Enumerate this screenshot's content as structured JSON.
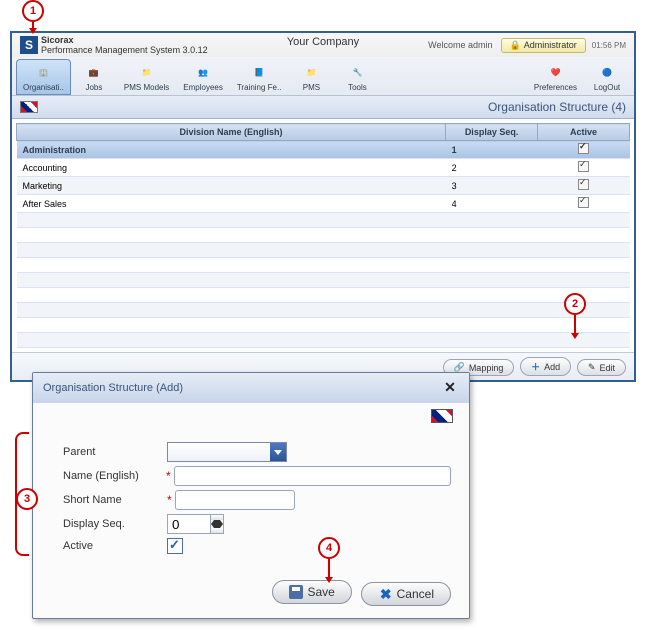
{
  "callouts": {
    "c1": "1",
    "c2": "2",
    "c3": "3",
    "c4": "4"
  },
  "header": {
    "app_name": "Sicorax",
    "subtitle": "Performance Management System 3.0.12",
    "company": "Your Company",
    "welcome": "Welcome admin",
    "admin_btn": "Administrator",
    "time": "01:56 PM"
  },
  "toolbar": [
    {
      "label": "Organisati..",
      "icon": "🏢",
      "selected": true
    },
    {
      "label": "Jobs",
      "icon": "💼"
    },
    {
      "label": "PMS Models",
      "icon": "📁"
    },
    {
      "label": "Employees",
      "icon": "👥"
    },
    {
      "label": "Training Fe..",
      "icon": "📘"
    },
    {
      "label": "PMS",
      "icon": "📁"
    },
    {
      "label": "Tools",
      "icon": "🔧"
    }
  ],
  "toolbar_right": [
    {
      "label": "Preferences",
      "icon": "❤️"
    },
    {
      "label": "LogOut",
      "icon": "🔵"
    }
  ],
  "pane": {
    "title": "Organisation Structure (4)"
  },
  "grid": {
    "columns": [
      "Division Name (English)",
      "Display Seq.",
      "Active"
    ],
    "rows": [
      {
        "name": "Administration",
        "seq": "1",
        "active": true,
        "selected": true
      },
      {
        "name": "Accounting",
        "seq": "2",
        "active": true
      },
      {
        "name": "Marketing",
        "seq": "3",
        "active": true
      },
      {
        "name": "After Sales",
        "seq": "4",
        "active": true
      }
    ]
  },
  "grid_buttons": {
    "mapping": "Mapping",
    "add": "Add",
    "edit": "Edit"
  },
  "dialog": {
    "title": "Organisation Structure (Add)",
    "labels": {
      "parent": "Parent",
      "name": "Name (English)",
      "short": "Short Name",
      "seq": "Display Seq.",
      "active": "Active"
    },
    "values": {
      "parent": "",
      "name": "",
      "short": "",
      "seq": "0",
      "active": true
    },
    "buttons": {
      "save": "Save",
      "cancel": "Cancel"
    }
  }
}
